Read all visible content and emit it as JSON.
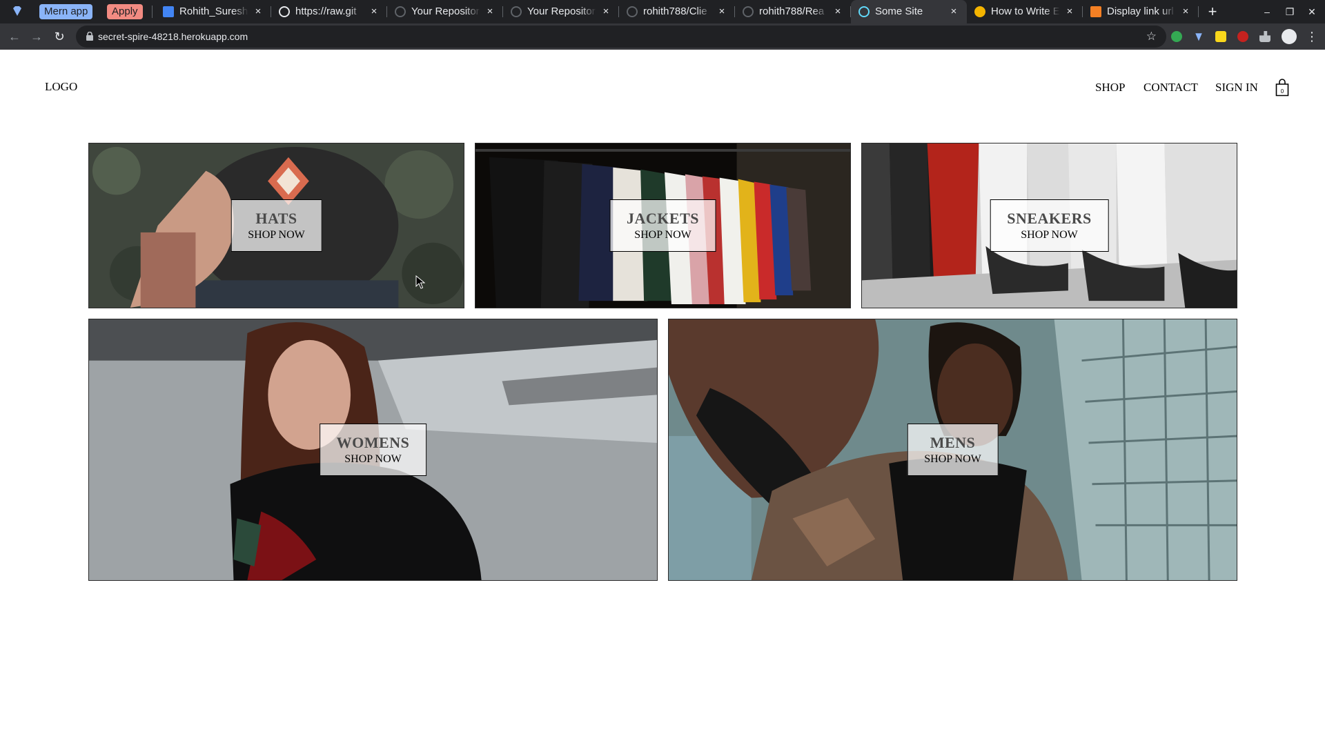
{
  "browser": {
    "pinned_tabs": [
      "Mern app",
      "Apply"
    ],
    "tabs": [
      {
        "title": "Rohith_Suresh",
        "icon_color": "#4285f4"
      },
      {
        "title": "https://raw.git",
        "icon_color": "#e8eaed"
      },
      {
        "title": "Your Repositor",
        "icon_color": "#5f6368"
      },
      {
        "title": "Your Repositor",
        "icon_color": "#5f6368"
      },
      {
        "title": "rohith788/Clie",
        "icon_color": "#5f6368"
      },
      {
        "title": "rohith788/Rea",
        "icon_color": "#5f6368"
      },
      {
        "title": "Some Site",
        "icon_color": "#61dafb"
      },
      {
        "title": "How to Write E",
        "icon_color": "#f4b400"
      },
      {
        "title": "Display link url",
        "icon_color": "#f48024"
      }
    ],
    "active_tab_index": 6,
    "close_glyph": "×",
    "new_tab_glyph": "+",
    "url": "secret-spire-48218.herokuapp.com",
    "accent_color": "#8ab4f8"
  },
  "site": {
    "logo": "LOGO",
    "nav": {
      "shop": "SHOP",
      "contact": "CONTACT",
      "sign_in": "SIGN IN"
    },
    "cart_count": "0"
  },
  "categories": [
    {
      "title": "HATS",
      "subtitle": "SHOP NOW"
    },
    {
      "title": "JACKETS",
      "subtitle": "SHOP NOW"
    },
    {
      "title": "SNEAKERS",
      "subtitle": "SHOP NOW"
    },
    {
      "title": "WOMENS",
      "subtitle": "SHOP NOW"
    },
    {
      "title": "MENS",
      "subtitle": "SHOP NOW"
    }
  ]
}
